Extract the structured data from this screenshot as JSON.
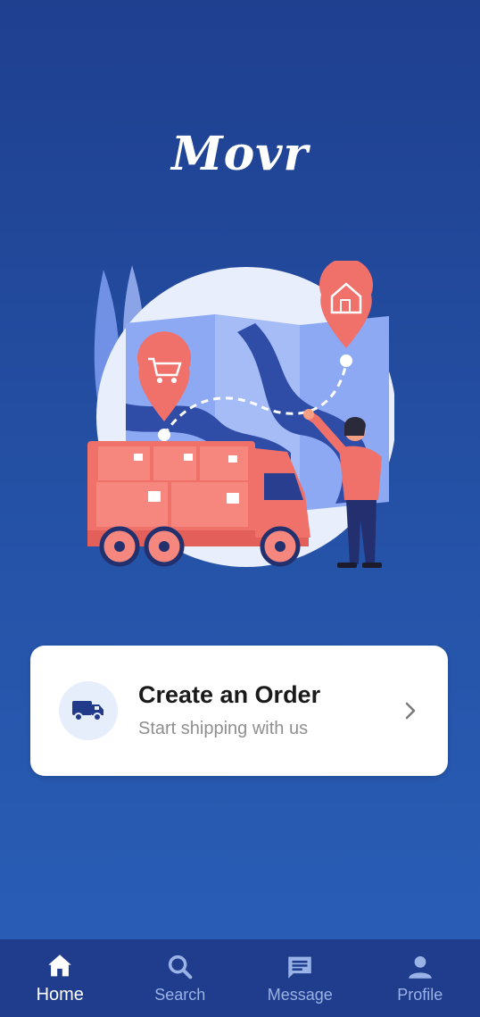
{
  "app": {
    "logo_text": "Movr"
  },
  "card": {
    "title": "Create an Order",
    "subtitle": "Start shipping with us",
    "icon": "truck-icon"
  },
  "bottom_nav": {
    "items": [
      {
        "label": "Home",
        "icon": "home-icon",
        "active": true
      },
      {
        "label": "Search",
        "icon": "search-icon",
        "active": false
      },
      {
        "label": "Message",
        "icon": "message-icon",
        "active": false
      },
      {
        "label": "Profile",
        "icon": "profile-icon",
        "active": false
      }
    ]
  },
  "colors": {
    "background_top": "#1f3f8f",
    "background_bottom": "#2a5fb8",
    "nav_background": "#1f3d8c",
    "accent_red": "#f0706a",
    "card_icon_bg": "#e6eefb",
    "truck_icon": "#223a8a"
  }
}
